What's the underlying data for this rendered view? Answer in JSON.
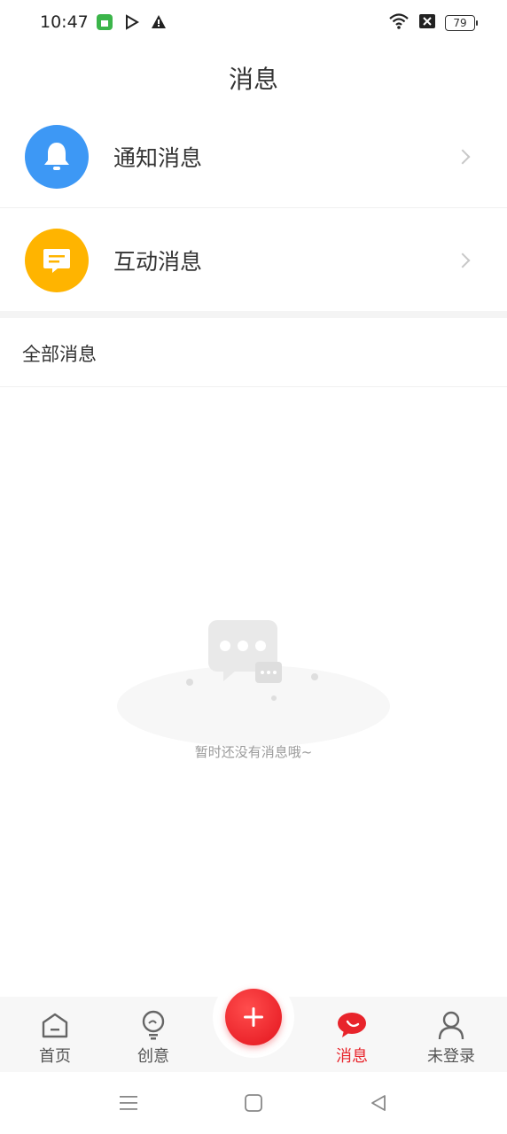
{
  "status_bar": {
    "time": "10:47",
    "battery": "79",
    "icons": [
      "app-store-icon",
      "play-icon",
      "warning-icon",
      "wifi-icon",
      "no-sim-icon",
      "battery-icon"
    ]
  },
  "header": {
    "title": "消息"
  },
  "entries": [
    {
      "label": "通知消息",
      "icon": "bell-icon",
      "color": "#3d98f5"
    },
    {
      "label": "互动消息",
      "icon": "comment-icon",
      "color": "#ffb400"
    }
  ],
  "section": {
    "title": "全部消息"
  },
  "empty_state": {
    "text": "暂时还没有消息哦~"
  },
  "tabbar": {
    "tabs": [
      {
        "label": "首页",
        "icon": "home-icon"
      },
      {
        "label": "创意",
        "icon": "lightbulb-icon"
      },
      {
        "label": "消息",
        "icon": "message-icon",
        "active": true
      },
      {
        "label": "未登录",
        "icon": "user-icon"
      }
    ],
    "fab_icon": "plus-icon",
    "accent": "#e8242b"
  },
  "system_nav": {
    "buttons": [
      "menu-icon",
      "home-square-icon",
      "back-triangle-icon"
    ]
  }
}
